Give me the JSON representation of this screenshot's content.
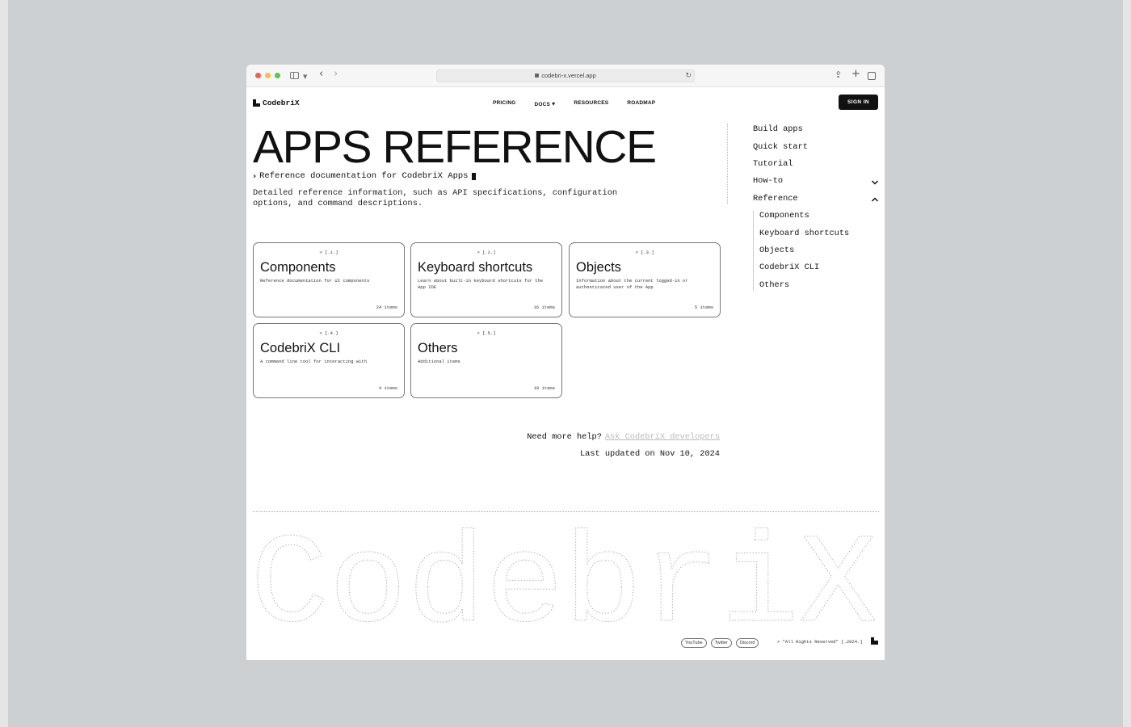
{
  "browser": {
    "url": "codebri-x.vercel.app"
  },
  "header": {
    "brand": "CodebriX",
    "nav": [
      "PRICING",
      "DOCS",
      "RESOURCES",
      "ROADMAP"
    ],
    "docs_caret": "▾",
    "signin_label": "SIGN IN"
  },
  "main": {
    "title": "APPS REFERENCE",
    "subtitle": "Reference documentation for CodebriX Apps",
    "description": "Detailed reference information, such as API specifications, configuration options, and command descriptions.",
    "cards": [
      {
        "index": "> [.1.]",
        "title": "Components",
        "desc": "Reference documentation for UI components",
        "count": "24 items"
      },
      {
        "index": "> [.2.]",
        "title": "Keyboard shortcuts",
        "desc": "Learn about built-in keyboard shortcuts for the App IDE",
        "count": "16 items"
      },
      {
        "index": "> [.3.]",
        "title": "Objects",
        "desc": "Information about the current logged-in or authenticated user of the App",
        "count": "5 items"
      },
      {
        "index": "> [.4.]",
        "title": "CodebriX CLI",
        "desc": "A command line tool for interacting with",
        "count": "4 items"
      },
      {
        "index": "> [.5.]",
        "title": "Others",
        "desc": "Additional items",
        "count": "10 items"
      }
    ],
    "help_text": "Need more help?",
    "help_link": "Ask CodebriX developers",
    "updated": "Last updated on Nov 10, 2024"
  },
  "sidebar": {
    "items": [
      "Build apps",
      "Quick start",
      "Tutorial",
      "How-to",
      "Reference"
    ],
    "sub_items": [
      "Components",
      "Keyboard shortcuts",
      "Objects",
      "CodebriX CLI",
      "Others"
    ]
  },
  "footer": {
    "wordmark": "CodebriX",
    "links": [
      "YouTube",
      "Twitter",
      "Discord"
    ],
    "copyright": "> \"All Rights Reserved\" [.2024.]"
  }
}
